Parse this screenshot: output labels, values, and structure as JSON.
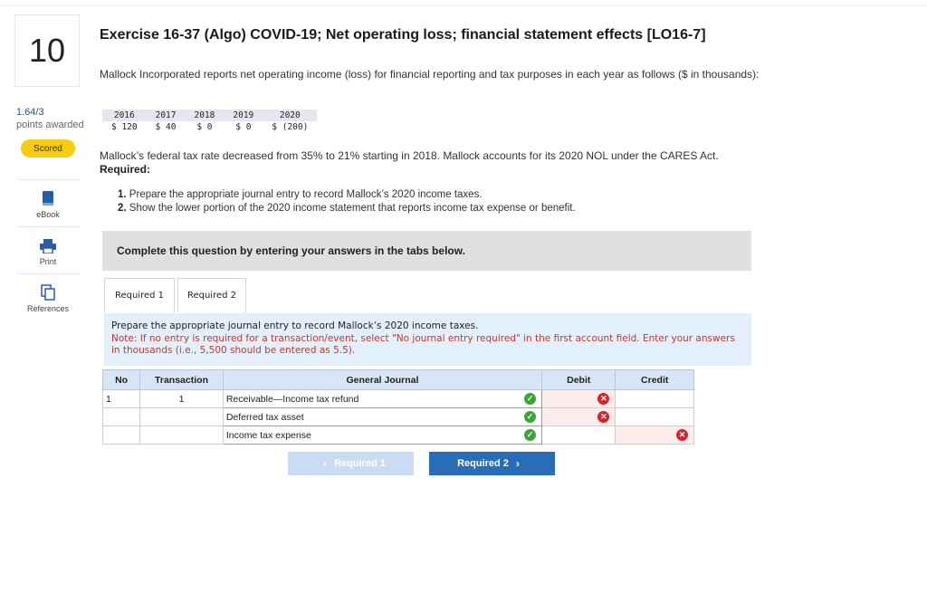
{
  "question": {
    "number": "10",
    "points": "1.64/3",
    "points_label": "points awarded",
    "status_badge": "Scored"
  },
  "tools": [
    {
      "label": "eBook",
      "icon": "book-icon"
    },
    {
      "label": "Print",
      "icon": "printer-icon"
    },
    {
      "label": "References",
      "icon": "references-icon"
    }
  ],
  "title": "Exercise 16-37 (Algo) COVID-19; Net operating loss; financial statement effects [LO16-7]",
  "intro": "Mallock Incorporated reports net operating income (loss) for financial reporting and tax purposes in each year as follows ($ in thousands):",
  "income_table": {
    "years": [
      "2016",
      "2017",
      "2018",
      "2019",
      "2020"
    ],
    "values": [
      "$ 120",
      "$ 40",
      "$ 0",
      "$ 0",
      "$ (200)"
    ]
  },
  "rate_text": "Mallock’s federal tax rate decreased from 35% to 21% starting in 2018. Mallock accounts for its 2020 NOL under the CARES Act.",
  "required_heading": "Required:",
  "requirements": [
    {
      "num": "1.",
      "text": "Prepare the appropriate journal entry to record Mallock’s 2020 income taxes."
    },
    {
      "num": "2.",
      "text": "Show the lower portion of the 2020 income statement that reports income tax expense or benefit."
    }
  ],
  "complete_banner": "Complete this question by entering your answers in the tabs below.",
  "tabs": [
    "Required 1",
    "Required 2"
  ],
  "instructions": {
    "main": "Prepare the appropriate journal entry to record Mallock’s 2020 income taxes.",
    "note": "Note: If no entry is required for a transaction/event, select \"No journal entry required\" in the first account field. Enter your answers in thousands (i.e., 5,500 should be entered as 5.5)."
  },
  "journal": {
    "headers": [
      "No",
      "Transaction",
      "General Journal",
      "Debit",
      "Credit"
    ],
    "rows": [
      {
        "no": "1",
        "transaction": "1",
        "account": "Receivable—Income tax refund",
        "debit": "",
        "credit": ""
      },
      {
        "no": "",
        "transaction": "",
        "account": "Deferred tax asset",
        "debit": "",
        "credit": ""
      },
      {
        "no": "",
        "transaction": "",
        "account": "Income tax expense",
        "debit": "",
        "credit": ""
      }
    ]
  },
  "nav": {
    "prev_label": "Required 1",
    "next_label": "Required 2"
  },
  "colors": {
    "badge": "#f5cc10",
    "header_blue": "#d7e5f4",
    "instr_bg": "#e3f0fb",
    "note_red": "#c0392b",
    "correct_green": "#3aa639",
    "wrong_red": "#d0262d",
    "next_button": "#2a6cb7"
  }
}
